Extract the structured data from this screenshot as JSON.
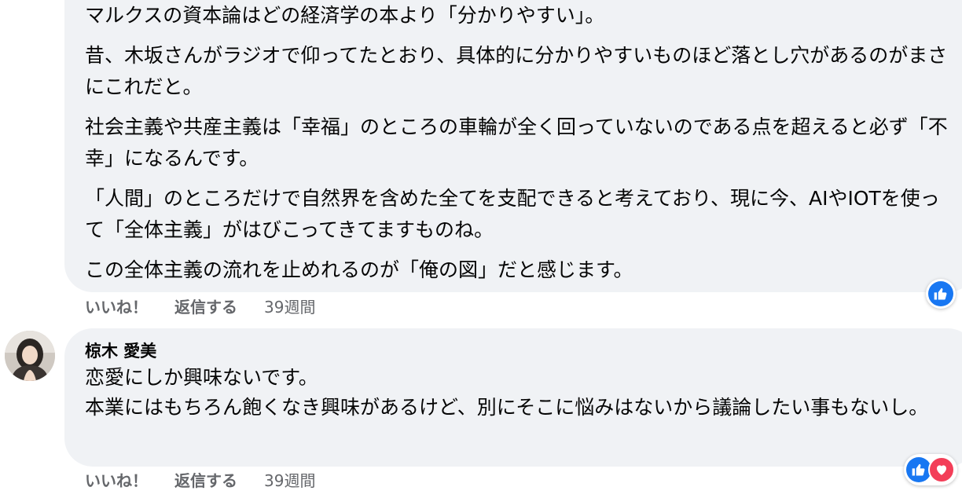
{
  "comments": [
    {
      "paragraphs": [
        "マルクスの資本論はどの経済学の本より「分かりやすい」。",
        "昔、木坂さんがラジオで仰ってたとおり、具体的に分かりやすいものほど落とし穴があるのがまさにこれだと。",
        "社会主義や共産主義は「幸福」のところの車輪が全く回っていないのである点を超えると必ず「不幸」になるんです。",
        "「人間」のところだけで自然界を含めた全てを支配できると考えており、現に今、AIやIOTを使って「全体主義」がはびこってきてますものね。",
        "この全体主義の流れを止めれるのが「俺の図」だと感じます。"
      ],
      "actions": {
        "like": "いいね！",
        "reply": "返信する",
        "time": "39週間"
      },
      "reactions": [
        "like-icon"
      ]
    },
    {
      "author": "椋木 愛美",
      "paragraphs": [
        "恋愛にしか興味ないです。",
        "本業にはもちろん飽くなき興味があるけど、別にそこに悩みはないから議論したい事もないし。"
      ],
      "actions": {
        "like": "いいね！",
        "reply": "返信する",
        "time": "39週間"
      },
      "reactions": [
        "like-icon",
        "love-icon"
      ]
    }
  ],
  "colors": {
    "bubble": "#f0f2f5",
    "text": "#050505",
    "meta": "#65676b",
    "like": "#1877f2",
    "love": "#f33e58"
  }
}
